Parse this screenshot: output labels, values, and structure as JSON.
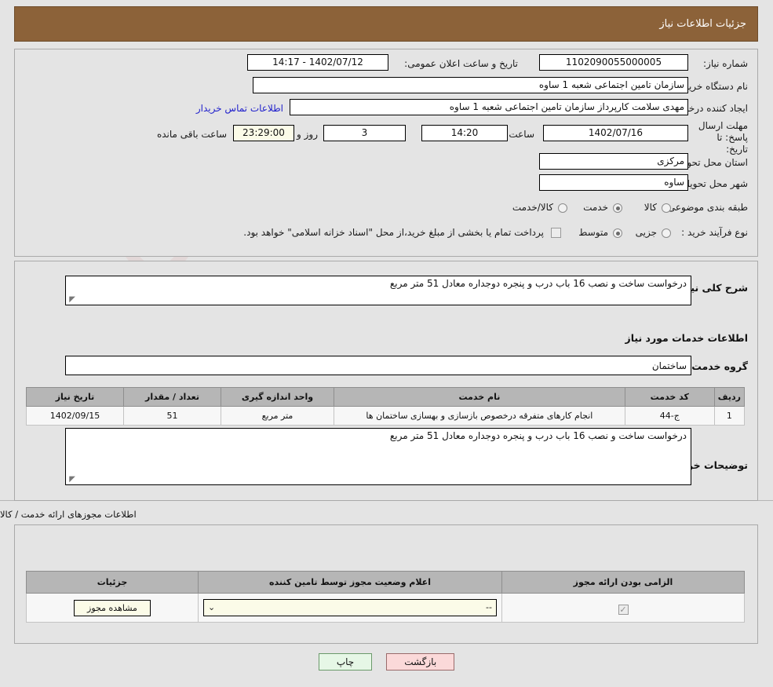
{
  "header": {
    "title": "جزئیات اطلاعات نیاز"
  },
  "main": {
    "need_number_label": "شماره نیاز:",
    "need_number_value": "1102090055000005",
    "announce_label": "تاریخ و ساعت اعلان عمومی:",
    "announce_value": "1402/07/12 - 14:17",
    "buyer_org_label": "نام دستگاه خریدار:",
    "buyer_org_value": "سازمان تامین اجتماعی شعبه 1 ساوه",
    "creator_label": "ایجاد کننده درخواست:",
    "creator_value": "مهدی سلامت کارپرداز سازمان تامین اجتماعی شعبه 1 ساوه",
    "contact_link": "اطلاعات تماس خریدار",
    "deadline_label": "مهلت ارسال پاسخ: تا تاریخ:",
    "deadline_date": "1402/07/16",
    "hour_label": "ساعت",
    "deadline_time": "14:20",
    "days_value": "3",
    "days_label": "روز و",
    "remaining_value": "23:29:00",
    "remaining_label": "ساعت باقی مانده",
    "province_label": "استان محل تحویل:",
    "province_value": "مرکزی",
    "city_label": "شهر محل تحویل:",
    "city_value": "ساوه",
    "category_label": "طبقه بندی موضوعی:",
    "category_options": [
      "کالا",
      "خدمت",
      "کالا/خدمت"
    ],
    "category_selected": "خدمت",
    "process_label": "نوع فرآیند خرید :",
    "process_options": [
      "جزیی",
      "متوسط"
    ],
    "process_selected": "متوسط",
    "treasury_checkbox_checked": false,
    "treasury_note": "پرداخت تمام یا بخشی از مبلغ خرید،از محل \"اسناد خزانه اسلامی\" خواهد بود."
  },
  "description": {
    "general_label": "شرح کلی نیاز:",
    "general_value": "درخواست ساخت و نصب 16 باب درب و پنجره دوجداره معادل 51 متر مربع",
    "services_section_title": "اطلاعات خدمات مورد نیاز",
    "service_group_label": "گروه خدمت:",
    "service_group_value": "ساختمان",
    "table": {
      "columns": [
        "ردیف",
        "کد خدمت",
        "نام خدمت",
        "واحد اندازه گیری",
        "تعداد / مقدار",
        "تاریخ نیاز"
      ],
      "rows": [
        {
          "row": "1",
          "service_code": "ج-44",
          "service_name": "انجام کارهای متفرقه درخصوص بازسازی و بهسازی ساختمان ها",
          "unit": "متر مربع",
          "quantity": "51",
          "need_date": "1402/09/15"
        }
      ]
    },
    "buyer_notes_label": "توضیحات خریدار:",
    "buyer_notes_value": "درخواست ساخت و نصب 16 باب درب و پنجره دوجداره معادل 51 متر مربع"
  },
  "licenses": {
    "caption": "اطلاعات مجوزهای ارائه خدمت / کالا",
    "columns": [
      "الزامی بودن ارائه مجوز",
      "اعلام وضعیت مجوز توسط تامین کننده",
      "جزئیات"
    ],
    "rows": [
      {
        "required_checked": true,
        "status_value": "--",
        "details_button": "مشاهده مجوز"
      }
    ]
  },
  "footer": {
    "back_label": "بازگشت",
    "print_label": "چاپ"
  },
  "colors": {
    "header_bar": "#8c6239",
    "link": "#2222cc",
    "back_button": "#fbd9d9",
    "print_button": "#e6f7e6",
    "grid_header": "#b6b6b6",
    "cream_field": "#fbfbe8"
  },
  "watermark": {
    "text": "AnaTender.net"
  }
}
